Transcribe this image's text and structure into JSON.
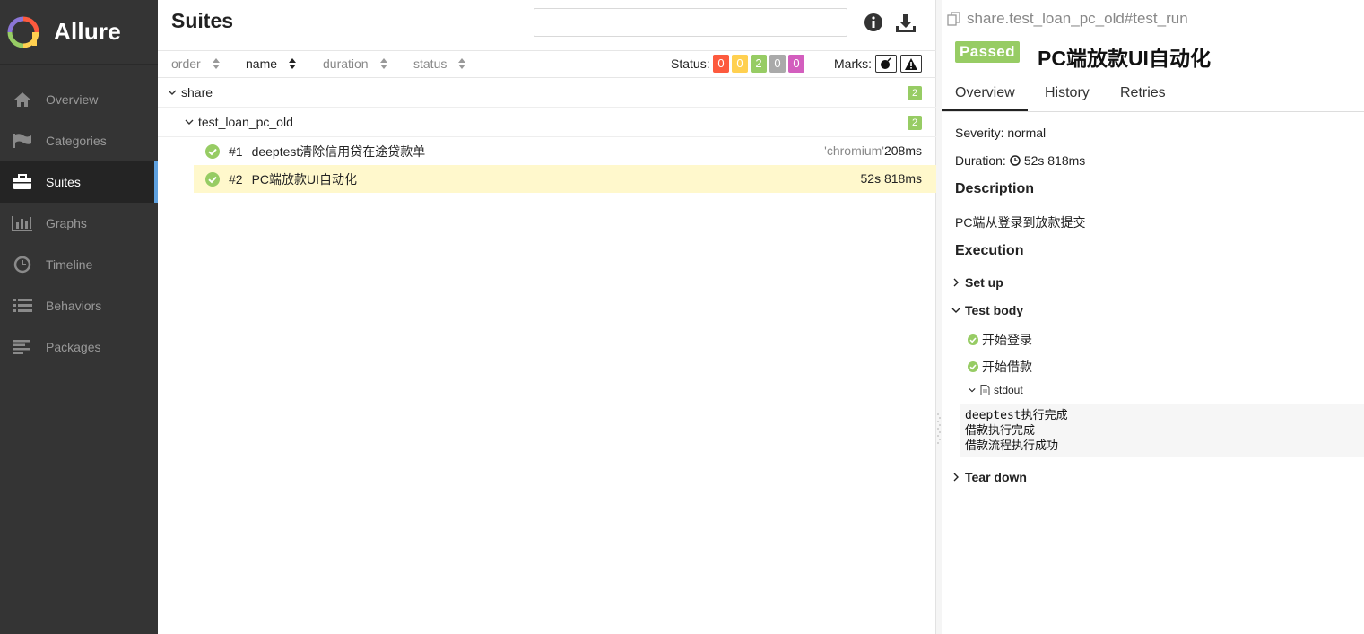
{
  "brand": {
    "name": "Allure"
  },
  "sidebar": {
    "items": [
      {
        "label": "Overview",
        "icon": "home-icon"
      },
      {
        "label": "Categories",
        "icon": "flag-icon"
      },
      {
        "label": "Suites",
        "icon": "briefcase-icon",
        "active": true
      },
      {
        "label": "Graphs",
        "icon": "bar-chart-icon"
      },
      {
        "label": "Timeline",
        "icon": "clock-icon"
      },
      {
        "label": "Behaviors",
        "icon": "list-icon"
      },
      {
        "label": "Packages",
        "icon": "align-left-icon"
      }
    ],
    "active_accent": "#5ea1e0"
  },
  "suites": {
    "title": "Suites",
    "search": {
      "value": "",
      "placeholder": ""
    },
    "sort": {
      "order": "order",
      "name": "name",
      "duration": "duration",
      "status": "status"
    },
    "status_label": "Status:",
    "status_counts": [
      {
        "value": "0",
        "color": "#fd5a3e"
      },
      {
        "value": "0",
        "color": "#ffd050"
      },
      {
        "value": "2",
        "color": "#97cc64"
      },
      {
        "value": "0",
        "color": "#aaaaaa"
      },
      {
        "value": "0",
        "color": "#d35ebe"
      }
    ],
    "marks_label": "Marks:",
    "tree": {
      "root": {
        "name": "share",
        "count": "2"
      },
      "suite": {
        "name": "test_loan_pc_old",
        "count": "2"
      },
      "cases": [
        {
          "num": "#1",
          "name": "deeptest清除信用贷在途贷款单",
          "param": "'chromium'",
          "duration": "208ms",
          "status": "passed"
        },
        {
          "num": "#2",
          "name": "PC端放款UI自动化",
          "param": "",
          "duration": "52s 818ms",
          "status": "passed",
          "selected": true
        }
      ]
    }
  },
  "detail": {
    "breadcrumb": "share.test_loan_pc_old#test_run",
    "status": "Passed",
    "title": "PC端放款UI自动化",
    "tabs": [
      "Overview",
      "History",
      "Retries"
    ],
    "severity": "Severity: normal",
    "duration_label": "Duration:",
    "duration_value": "52s 818ms",
    "description_heading": "Description",
    "description": "PC端从登录到放款提交",
    "execution_heading": "Execution",
    "setup": "Set up",
    "test_body": "Test body",
    "steps": [
      "开始登录",
      "开始借款"
    ],
    "stdout_label": "stdout",
    "stdout_lines": [
      "deeptest执行完成",
      "借款执行完成",
      "借款流程执行成功"
    ],
    "teardown": "Tear down"
  }
}
